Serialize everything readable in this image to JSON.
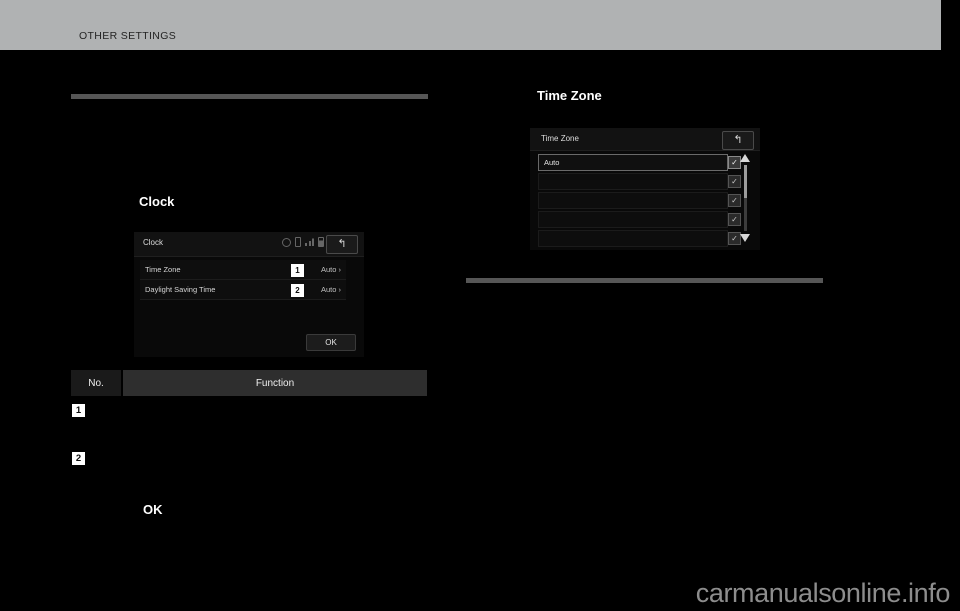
{
  "page": {
    "header_title": "OTHER SETTINGS",
    "watermark": "carmanualsonline.info"
  },
  "left_column": {
    "subhead_clock": "Clock",
    "ok_label": "OK",
    "clock_screen": {
      "title": "Clock",
      "back_icon": "↰",
      "status_icons": [
        "gear-icon",
        "phone-icon",
        "signal-bars-icon",
        "battery-icon"
      ],
      "rows": [
        {
          "label": "Time Zone",
          "callout": "1",
          "value": "Auto ›"
        },
        {
          "label": "Daylight Saving Time",
          "callout": "2",
          "value": "Auto ›"
        }
      ],
      "ok_button": "OK"
    },
    "function_table": {
      "headers": {
        "no": "No.",
        "function": "Function"
      },
      "rows": [
        {
          "no": "1",
          "text": ""
        },
        {
          "no": "2",
          "text": ""
        }
      ]
    }
  },
  "right_column": {
    "subhead_timezone": "Time Zone",
    "timezone_screen": {
      "title": "Time Zone",
      "back_icon": "↰",
      "rows": [
        {
          "label": "Auto",
          "selected": true,
          "check": "✓"
        },
        {
          "label": "",
          "selected": false,
          "check": "✓"
        },
        {
          "label": "",
          "selected": false,
          "check": "✓"
        },
        {
          "label": "",
          "selected": false,
          "check": "✓"
        },
        {
          "label": "",
          "selected": false,
          "check": "✓"
        }
      ],
      "scroll_up_icon": "▲",
      "scroll_down_icon": "▼"
    }
  }
}
